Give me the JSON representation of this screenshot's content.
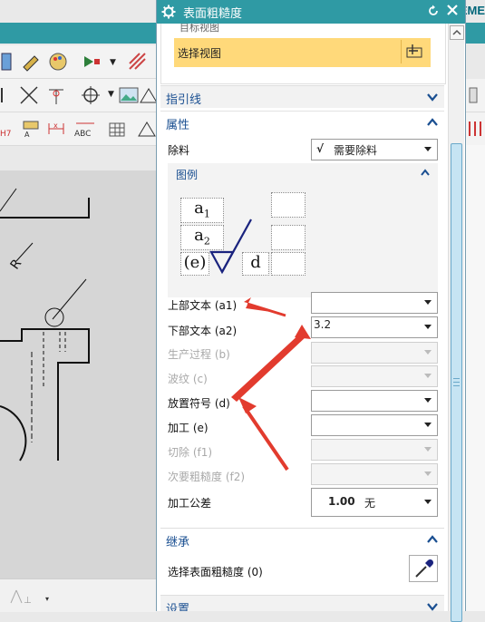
{
  "background": {
    "brand_fragment": "SIEME"
  },
  "dialog": {
    "title": "表面粗糙度",
    "header_cut_text": "目标视图",
    "select_view_label": "选择视图",
    "sections": {
      "leader": "指引线",
      "properties": "属性",
      "inherit": "继承",
      "settings": "设置"
    },
    "material_removal": {
      "label": "除料",
      "value": "需要除料",
      "symbol": "√"
    },
    "legend": {
      "title": "图例",
      "a1": "a",
      "a1_sub": "1",
      "a2": "a",
      "a2_sub": "2",
      "e": "(e)",
      "d": "d"
    },
    "fields": [
      {
        "label": "上部文本 (a1)",
        "value": "",
        "enabled": true
      },
      {
        "label": "下部文本 (a2)",
        "value": "3.2",
        "enabled": true
      },
      {
        "label": "生产过程 (b)",
        "value": "",
        "enabled": false
      },
      {
        "label": "波纹 (c)",
        "value": "",
        "enabled": false
      },
      {
        "label": "放置符号 (d)",
        "value": "",
        "enabled": true
      },
      {
        "label": "加工 (e)",
        "value": "",
        "enabled": true
      },
      {
        "label": "切除 (f1)",
        "value": "",
        "enabled": false
      },
      {
        "label": "次要粗糙度 (f2)",
        "value": "",
        "enabled": false
      }
    ],
    "tolerance": {
      "label": "加工公差",
      "value": "1.00",
      "unit": "无"
    },
    "inherit_select_label": "选择表面粗糙度 (0)"
  },
  "colors": {
    "titlebar": "#2f9aa4",
    "section_text": "#1a4f91",
    "selection_highlight": "#ffd97a",
    "annotation_arrow": "#e23b2e"
  }
}
